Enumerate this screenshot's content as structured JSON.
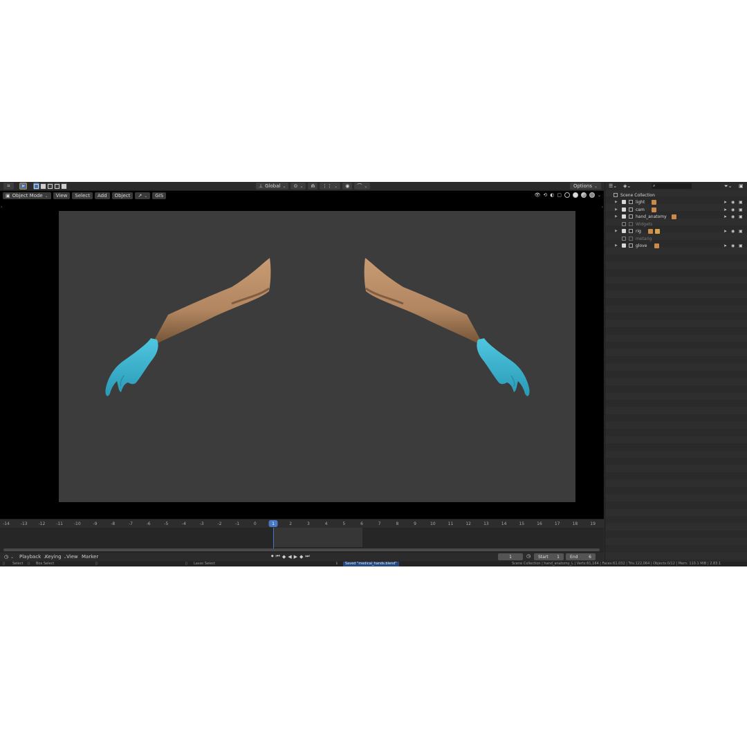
{
  "header": {
    "orientation": "Global",
    "options": "Options"
  },
  "viewport_header": {
    "mode": "Object Mode",
    "menus": [
      "View",
      "Select",
      "Add",
      "Object",
      "GIS"
    ]
  },
  "timeline": {
    "ticks": [
      "-14",
      "-13",
      "-12",
      "-11",
      "-10",
      "-9",
      "-8",
      "-7",
      "-6",
      "-5",
      "-4",
      "-3",
      "-2",
      "-1",
      "0",
      "1",
      "2",
      "3",
      "4",
      "5",
      "6",
      "7",
      "8",
      "9",
      "10",
      "11",
      "12",
      "13",
      "14",
      "15",
      "16",
      "17",
      "18",
      "19"
    ],
    "current_frame_marker": "1",
    "menus": [
      "Playback",
      "Keying",
      "View",
      "Marker"
    ],
    "frame": "1",
    "start_label": "Start",
    "start": "1",
    "end_label": "End",
    "end": "6"
  },
  "outliner": {
    "root": "Scene Collection",
    "rows": [
      {
        "label": "light",
        "dim": false
      },
      {
        "label": "cam",
        "dim": false
      },
      {
        "label": "hand_anatomy",
        "dim": false
      },
      {
        "label": "Widgets",
        "dim": true
      },
      {
        "label": "rig",
        "dim": false
      },
      {
        "label": "metarig",
        "dim": true
      },
      {
        "label": "glove",
        "dim": false
      }
    ]
  },
  "statusbar": {
    "select": "Select",
    "box_select": "Box Select",
    "lasso_select": "Lasso Select",
    "notice": "Saved \"medical_hands.blend\"",
    "stats": "Scene Collection | hand_anatomy_L | Verts:61,164 | Faces:61,032 | Tris:122,064 | Objects:0/12 | Mem: 110.1 MiB | 2.83.1"
  },
  "colors": {
    "skin": "#b58a63",
    "glove": "#3fb8d3",
    "accent": "#4a78c6"
  }
}
